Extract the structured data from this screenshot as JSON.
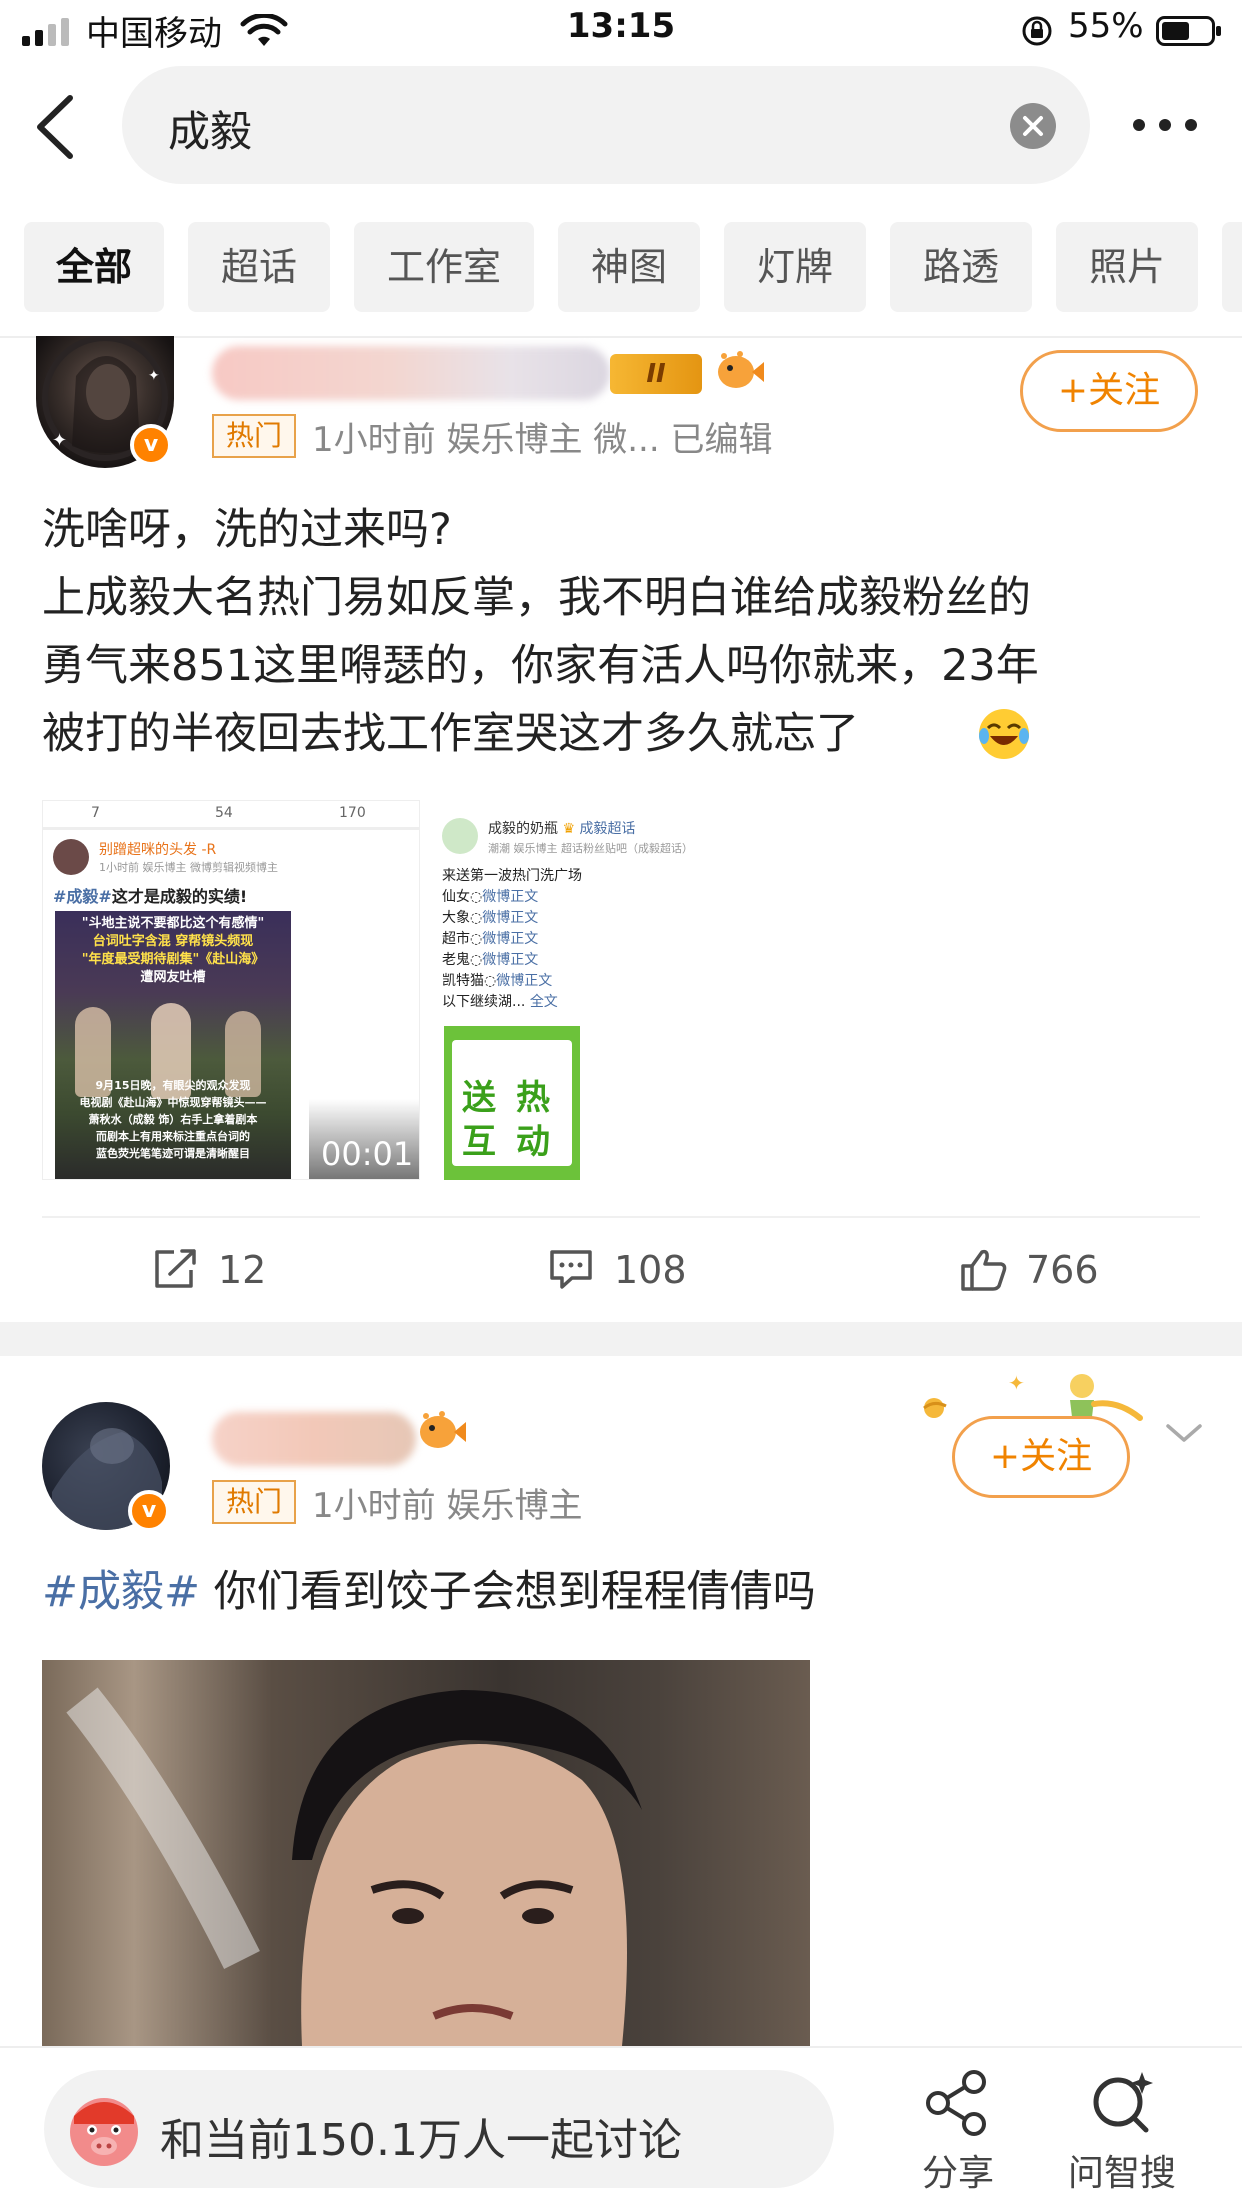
{
  "status_bar": {
    "carrier": "中国移动",
    "time": "13:15",
    "battery": "55%"
  },
  "search": {
    "query": "成毅"
  },
  "tabs": [
    "全部",
    "超话",
    "工作室",
    "神图",
    "灯牌",
    "路透",
    "照片"
  ],
  "posts": [
    {
      "rank_badge": "II",
      "hot": "热门",
      "meta": "1小时前   娱乐博主 微...   已编辑",
      "follow": "+关注",
      "text_lines": [
        "洗啥呀，洗的过来吗?",
        "上成毅大名热门易如反掌，我不明白谁给成毅粉丝的",
        "勇气来851这里嘚瑟的，你家有活人吗你就来，23年",
        "被打的半夜回去找工作室哭这才多久就忘了"
      ],
      "media": [
        {
          "stats": [
            "7",
            "54",
            "170"
          ],
          "author": "别蹭超咪的头发 -R",
          "sub": "1小时前 娱乐博主 微博剪辑视频博主",
          "topic": "#成毅#",
          "caption": "这才是成毅的实绩!",
          "headline": [
            "\"斗地主说不要都比这个有感情\"",
            "台词吐字含混 穿帮镜头频现",
            "\"年度最受期待剧集\"《赴山海》",
            "遭网友吐槽"
          ],
          "body": [
            "9月15日晚，有眼尖的观众发现",
            "电视剧《赴山海》中惊现穿帮镜头——",
            "萧秋水（成毅 饰）右手上拿着剧本",
            "而剧本上有用来标注重点台词的",
            "蓝色荧光笔笔迹可谓是清晰醒目"
          ],
          "duration": "00:01"
        },
        {
          "author": "成毅的奶瓶",
          "supertopic": "成毅超话",
          "sub": "潮潮  娱乐博主 超话粉丝贴吧（成毅超话）",
          "lines": [
            {
              "pre": "来送第一波热门洗广场",
              "link": ""
            },
            {
              "pre": "仙女◌",
              "link": "微博正文"
            },
            {
              "pre": "大象◌",
              "link": "微博正文"
            },
            {
              "pre": "超市◌",
              "link": "微博正文"
            },
            {
              "pre": "老鬼◌",
              "link": "微博正文"
            },
            {
              "pre": "凯特猫◌",
              "link": "微博正文"
            },
            {
              "pre": "以下继续湖... ",
              "link": "全文"
            }
          ],
          "poster_text": [
            "送",
            "热",
            "互",
            "动"
          ]
        }
      ],
      "actions": {
        "share": "12",
        "comment": "108",
        "like": "766"
      }
    },
    {
      "hot": "热门",
      "meta": "1小时前   娱乐博主",
      "follow": "+关注",
      "topic": "#成毅#",
      "text": " 你们看到饺子会想到程程倩倩吗"
    }
  ],
  "bottom_bar": {
    "discuss": "和当前150.1万人一起讨论",
    "share": "分享",
    "ask": "问智搜"
  },
  "colors": {
    "accent": "#f08300",
    "topic": "#4a6fa5",
    "hot_border": "#e8a24a"
  }
}
